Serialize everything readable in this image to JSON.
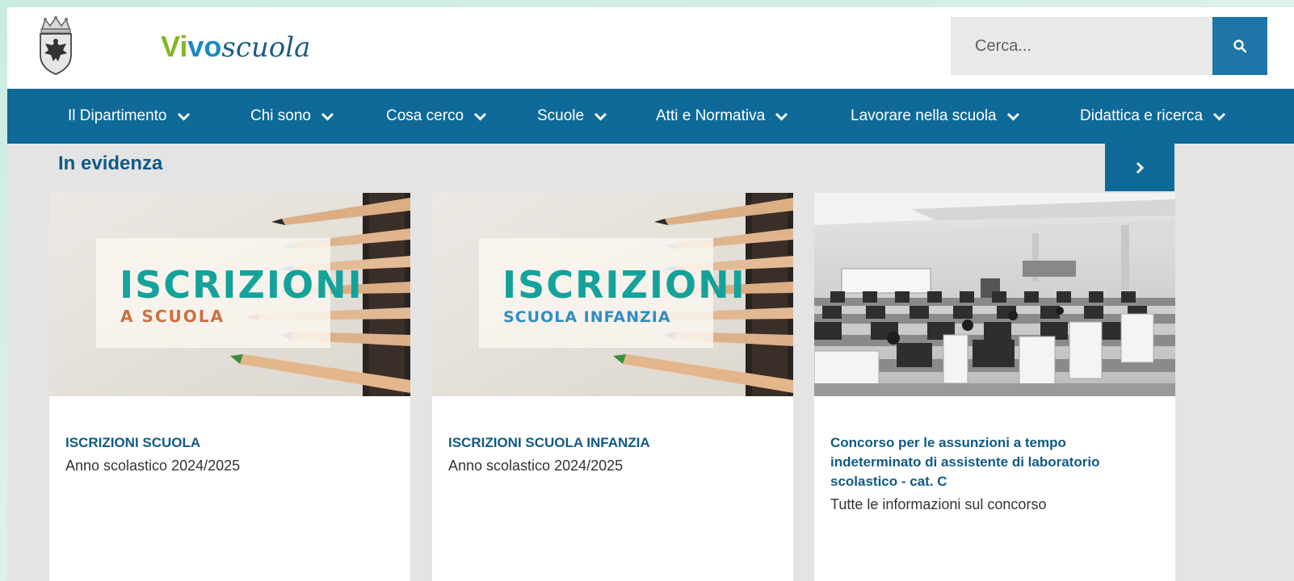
{
  "header": {
    "logo": {
      "part1": "Vi",
      "part2": "vo",
      "part3": "scuola"
    },
    "search": {
      "placeholder": "Cerca..."
    }
  },
  "nav": {
    "items": [
      {
        "label": "Il Dipartimento"
      },
      {
        "label": "Chi sono"
      },
      {
        "label": "Cosa cerco"
      },
      {
        "label": "Scuole"
      },
      {
        "label": "Atti e Normativa"
      },
      {
        "label": "Lavorare nella scuola"
      },
      {
        "label": "Didattica e ricerca"
      }
    ]
  },
  "section": {
    "title": "In evidenza"
  },
  "cards": [
    {
      "title": "ISCRIZIONI SCUOLA",
      "subtitle": "Anno scolastico 2024/2025",
      "image": {
        "headline": "ISCRIZIONI",
        "tagline": "A SCUOLA"
      }
    },
    {
      "title": "ISCRIZIONI SCUOLA INFANZIA",
      "subtitle": "Anno scolastico 2024/2025",
      "image": {
        "headline": "ISCRIZIONI",
        "tagline": "SCUOLA INFANZIA"
      }
    },
    {
      "title": "Concorso per le assunzioni a tempo indeterminato di assistente di laboratorio scolastico - cat. C",
      "subtitle": "Tutte le informazioni sul concorso"
    }
  ],
  "colors": {
    "nav_bg": "#0f6a99",
    "title_blue": "#105a86",
    "logo_green": "#84b527",
    "logo_blue": "#1a8ac4",
    "teal": "#14a29a",
    "orange": "#cf6f3d"
  },
  "icons": {
    "search": "search-icon",
    "chevron": "chevron-down-icon",
    "next": "chevron-right-icon",
    "crest": "crest-icon"
  }
}
